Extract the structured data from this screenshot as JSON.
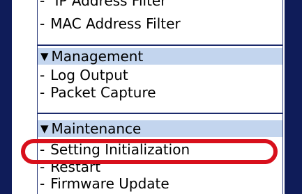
{
  "nav": {
    "clipped_top_item": "IP Address Filter",
    "items_filter": {
      "mac_filter": "MAC Address Filter"
    },
    "management": {
      "header": "Management",
      "log_output": "Log Output",
      "packet_capture": "Packet Capture"
    },
    "maintenance": {
      "header": "Maintenance",
      "setting_initialization": "Setting Initialization",
      "restart": "Restart",
      "firmware_update": "Firmware Update"
    },
    "dash": "-",
    "triangle": "▼"
  },
  "colors": {
    "frame": "#0f1c59",
    "header_bg": "#c3d5ee",
    "highlight": "#d8101c"
  }
}
